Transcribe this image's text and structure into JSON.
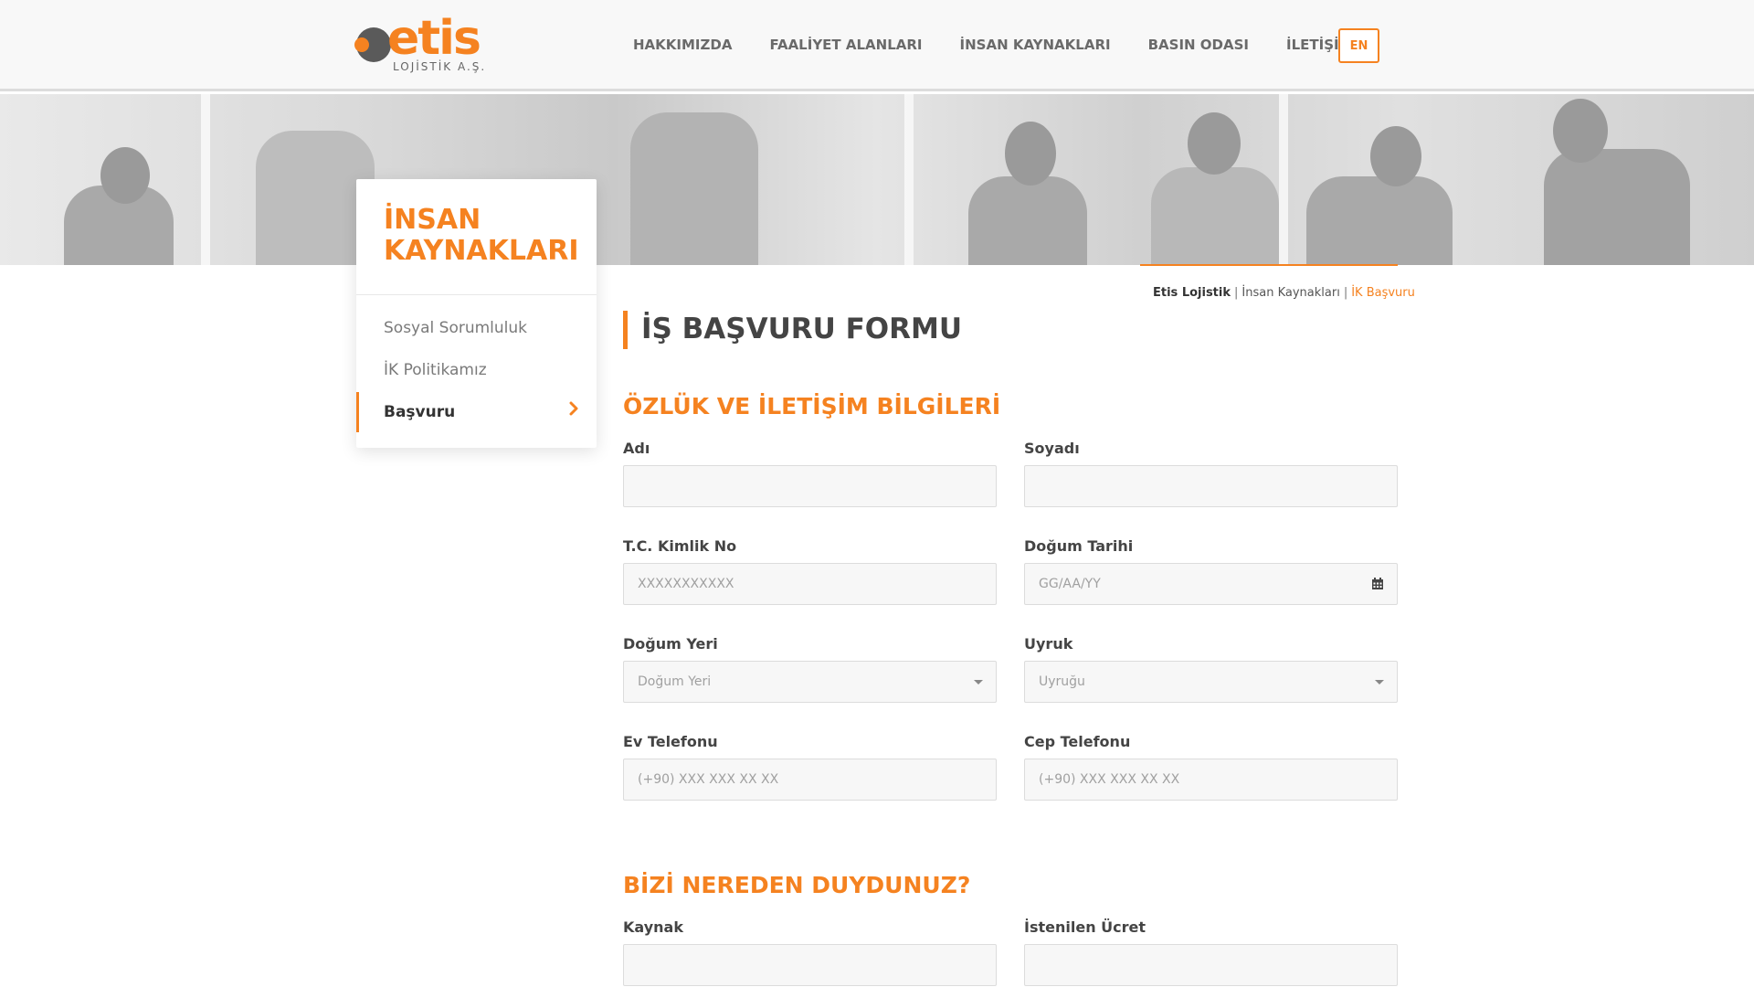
{
  "brand": {
    "name": "etis",
    "subtitle": "LOJİSTİK A.Ş.",
    "accent_color": "#f58220"
  },
  "nav": {
    "items": [
      {
        "label": "HAKKIMIZDA"
      },
      {
        "label": "FAALİYET ALANLARI"
      },
      {
        "label": "İNSAN KAYNAKLARI"
      },
      {
        "label": "BASIN ODASI"
      },
      {
        "label": "İLETİŞİM"
      }
    ],
    "lang": "EN"
  },
  "sidebar": {
    "title": "İNSAN KAYNAKLARI",
    "items": [
      {
        "label": "Sosyal Sorumluluk"
      },
      {
        "label": "İK Politikamız"
      },
      {
        "label": "Başvuru",
        "active": true
      }
    ]
  },
  "breadcrumb": {
    "items": [
      "Etis Lojistik",
      "İnsan Kaynakları",
      "İK Başvuru"
    ],
    "separator": "|"
  },
  "page_title": "İŞ BAŞVURU FORMU",
  "sections": {
    "personal": {
      "title": "ÖZLÜK VE İLETİŞİM BİLGİLERİ",
      "fields": {
        "first_name": {
          "label": "Adı",
          "placeholder": ""
        },
        "last_name": {
          "label": "Soyadı",
          "placeholder": ""
        },
        "tc_no": {
          "label": "T.C. Kimlik No",
          "placeholder": "XXXXXXXXXXX"
        },
        "birth_date": {
          "label": "Doğum Tarihi",
          "placeholder": "GG/AA/YY",
          "icon": "calendar-icon"
        },
        "birth_place": {
          "label": "Doğum Yeri",
          "placeholder": "Doğum Yeri"
        },
        "nationality": {
          "label": "Uyruk",
          "placeholder": "Uyruğu"
        },
        "home_phone": {
          "label": "Ev Telefonu",
          "placeholder": "(+90) XXX XXX XX XX"
        },
        "mobile_phone": {
          "label": "Cep Telefonu",
          "placeholder": "(+90) XXX XXX XX XX"
        }
      }
    },
    "source": {
      "title": "BİZİ NEREDEN DUYDUNUZ?",
      "fields": {
        "source": {
          "label": "Kaynak",
          "placeholder": ""
        },
        "salary": {
          "label": "İstenilen Ücret",
          "placeholder": ""
        }
      }
    }
  }
}
